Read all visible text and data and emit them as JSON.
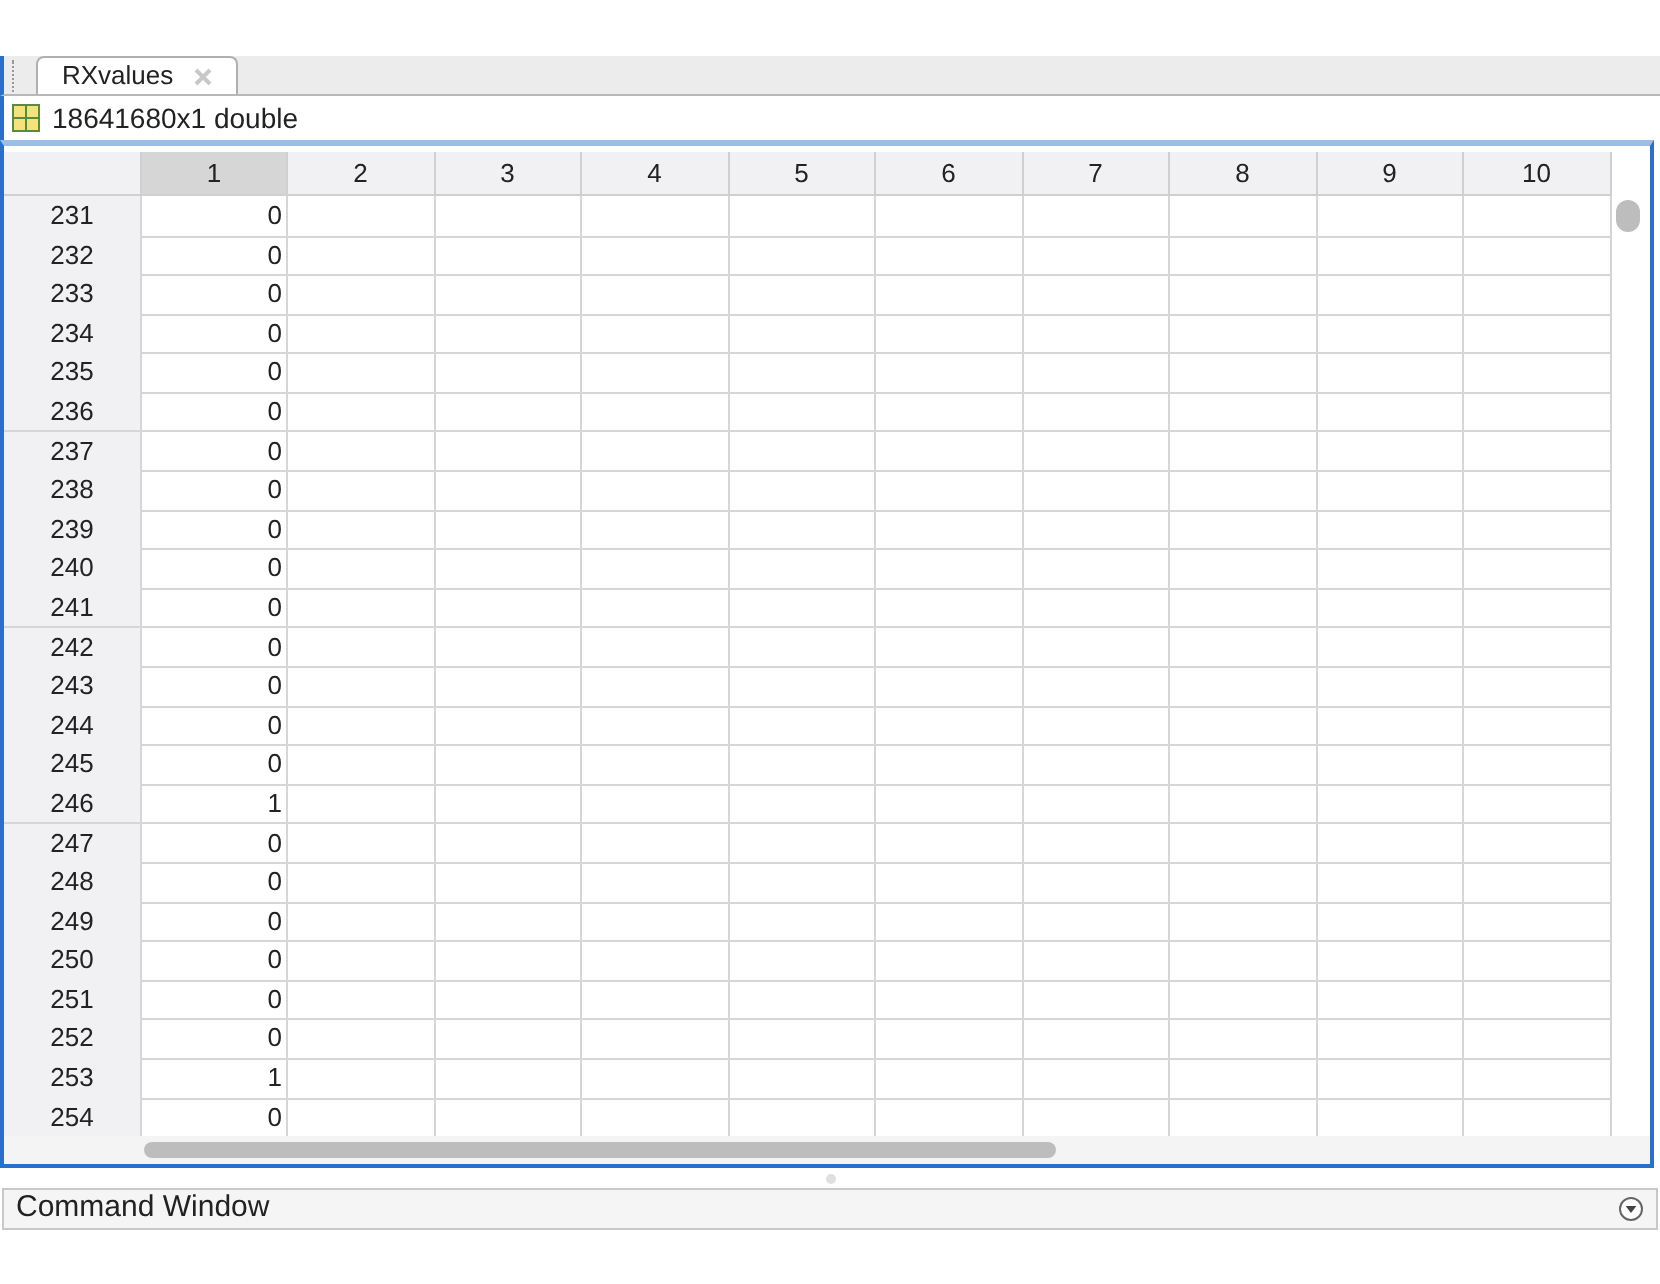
{
  "tab": {
    "label": "RXvalues",
    "selected": true
  },
  "variable": {
    "size_label": "18641680x1 double"
  },
  "table": {
    "columns": [
      {
        "label": "1",
        "selected": true
      },
      {
        "label": "2",
        "selected": false
      },
      {
        "label": "3",
        "selected": false
      },
      {
        "label": "4",
        "selected": false
      },
      {
        "label": "5",
        "selected": false
      },
      {
        "label": "6",
        "selected": false
      },
      {
        "label": "7",
        "selected": false
      },
      {
        "label": "8",
        "selected": false
      },
      {
        "label": "9",
        "selected": false
      },
      {
        "label": "10",
        "selected": false
      }
    ],
    "rows": [
      {
        "index": "231",
        "value": "0"
      },
      {
        "index": "232",
        "value": "0"
      },
      {
        "index": "233",
        "value": "0"
      },
      {
        "index": "234",
        "value": "0"
      },
      {
        "index": "235",
        "value": "0"
      },
      {
        "index": "236",
        "value": "0"
      },
      {
        "index": "237",
        "value": "0"
      },
      {
        "index": "238",
        "value": "0"
      },
      {
        "index": "239",
        "value": "0"
      },
      {
        "index": "240",
        "value": "0"
      },
      {
        "index": "241",
        "value": "0"
      },
      {
        "index": "242",
        "value": "0"
      },
      {
        "index": "243",
        "value": "0"
      },
      {
        "index": "244",
        "value": "0"
      },
      {
        "index": "245",
        "value": "0"
      },
      {
        "index": "246",
        "value": "1"
      },
      {
        "index": "247",
        "value": "0"
      },
      {
        "index": "248",
        "value": "0"
      },
      {
        "index": "249",
        "value": "0"
      },
      {
        "index": "250",
        "value": "0"
      },
      {
        "index": "251",
        "value": "0"
      },
      {
        "index": "252",
        "value": "0"
      },
      {
        "index": "253",
        "value": "1"
      },
      {
        "index": "254",
        "value": "0"
      }
    ]
  },
  "command_window": {
    "title": "Command Window"
  }
}
